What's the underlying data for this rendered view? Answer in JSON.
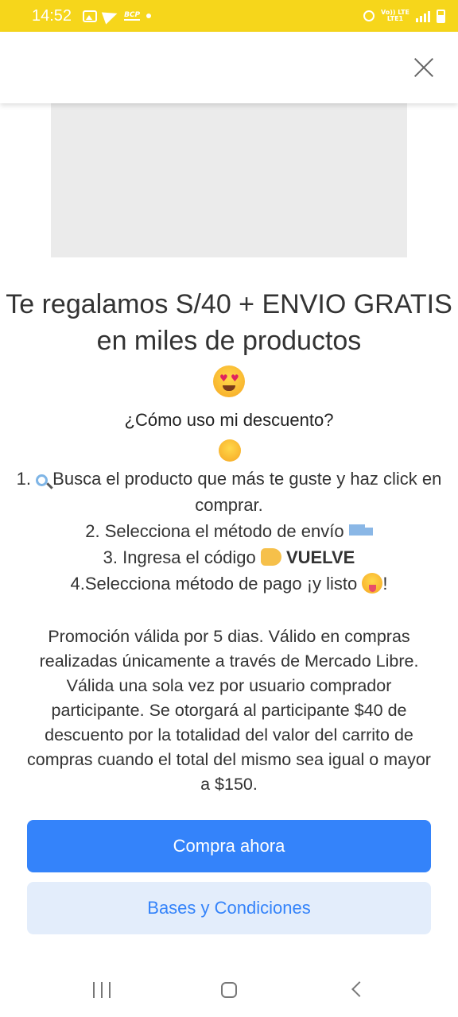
{
  "status_bar": {
    "time": "14:52",
    "left_icons": [
      "gallery-icon",
      "telegram-icon",
      "bcp-icon",
      "dot-icon"
    ],
    "bcp_label": "BCP",
    "network_label_top": "Vo)) LTE",
    "network_label_bottom": "LTE1",
    "right_icons": [
      "alarm-icon",
      "volte-icon",
      "signal-icon",
      "battery-icon"
    ]
  },
  "colors": {
    "status_bar": "#f6d61b",
    "primary_button": "#3483fa",
    "secondary_button_bg": "#e3edfb",
    "text": "#333333"
  },
  "modal": {
    "close_icon": "close-icon",
    "title": "Te regalamos S/40 + ENVIO GRATIS en miles de productos",
    "title_emoji": "heart-eyes-emoji",
    "subtitle": "¿Cómo uso mi descuento?",
    "subtitle_emoji": "thinking-emoji",
    "steps": {
      "s1_prefix": "1.",
      "s1_text": "Busca el producto que más te guste y haz click en comprar.",
      "s2_text": "2. Selecciona el método de envío",
      "s3_text": "3. Ingresa el código",
      "s3_code": "VUELVE",
      "s4_text": "4.Selecciona método de pago ¡y listo",
      "s4_suffix": "!"
    },
    "terms": "Promoción válida por 5 dias. Válido en compras realizadas únicamente a través de Mercado Libre. Válida una sola vez por usuario comprador participante. Se otorgará al participante $40 de descuento por la totalidad del valor del carrito de compras cuando el total del mismo sea igual o mayor a $150.",
    "primary_button": "Compra ahora",
    "secondary_button": "Bases y Condiciones"
  },
  "nav_bar": {
    "icons": [
      "recent-apps-icon",
      "home-icon",
      "back-icon"
    ]
  }
}
